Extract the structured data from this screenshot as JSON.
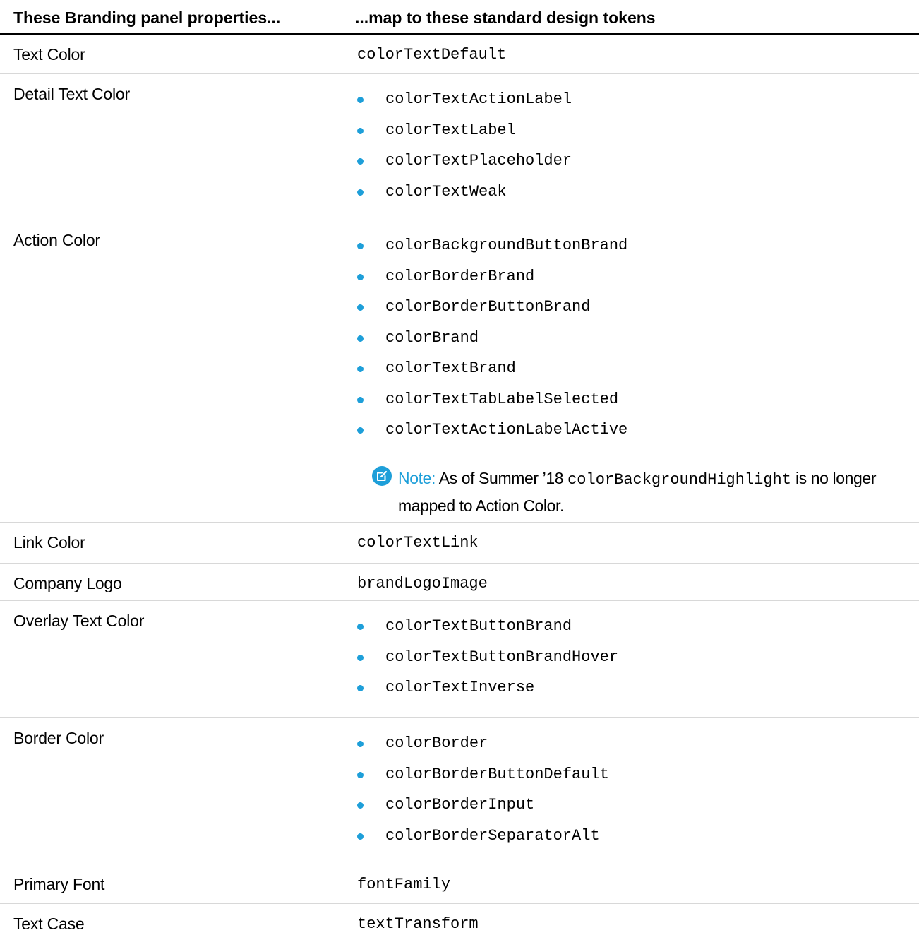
{
  "table": {
    "headers": {
      "col1": "These Branding panel properties...",
      "col2": "...map to these standard design tokens"
    },
    "rows": [
      {
        "property": "Text Color",
        "token": "colorTextDefault"
      },
      {
        "property": "Detail Text Color",
        "tokens": [
          "colorTextActionLabel",
          "colorTextLabel",
          "colorTextPlaceholder",
          "colorTextWeak"
        ]
      },
      {
        "property": "Action Color",
        "tokens": [
          "colorBackgroundButtonBrand",
          "colorBorderBrand",
          "colorBorderButtonBrand",
          "colorBrand",
          "colorTextBrand",
          "colorTextTabLabelSelected",
          "colorTextActionLabelActive"
        ],
        "note": {
          "label": "Note:",
          "text_before": "As of Summer ’18",
          "code": "colorBackgroundHighlight",
          "text_after": "is no longer",
          "text_line2": "mapped to Action Color."
        }
      },
      {
        "property": "Link Color",
        "token": "colorTextLink"
      },
      {
        "property": "Company Logo",
        "token": "brandLogoImage"
      },
      {
        "property": "Overlay Text Color",
        "tokens": [
          "colorTextButtonBrand",
          "colorTextButtonBrandHover",
          "colorTextInverse"
        ]
      },
      {
        "property": "Border Color",
        "tokens": [
          "colorBorder",
          "colorBorderButtonDefault",
          "colorBorderInput",
          "colorBorderSeparatorAlt"
        ]
      },
      {
        "property": "Primary Font",
        "token": "fontFamily"
      },
      {
        "property": "Text Case",
        "token": "textTransform"
      }
    ]
  },
  "colors": {
    "bullet": "#1e9fd9",
    "note_accent": "#1e9fd9",
    "divider": "#d8d8d8",
    "header_rule": "#000000"
  },
  "icons": {
    "note": "edit-note-icon"
  }
}
